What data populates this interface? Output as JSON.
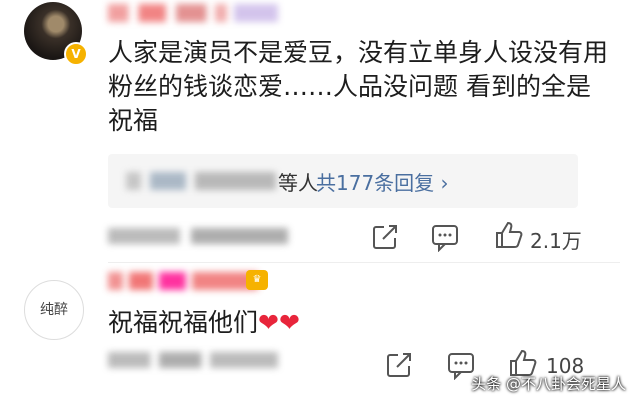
{
  "comment_1": {
    "text": "人家是演员不是爱豆，没有立单身人设没有用粉丝的钱谈恋爱……人品没问题 看到的全是祝福",
    "replies_suffix": "等人",
    "replies_link": "共177条回复 ›",
    "like_count": "2.1万"
  },
  "comment_2": {
    "avatar_text": "纯醉",
    "text": "祝福祝福他们",
    "hearts": "❤❤",
    "like_count": "108"
  },
  "watermark": "头条 @不八卦会死星人",
  "colors": {
    "link": "#4a6fa0",
    "heart": "#e8253b",
    "badge": "#f6b200"
  }
}
